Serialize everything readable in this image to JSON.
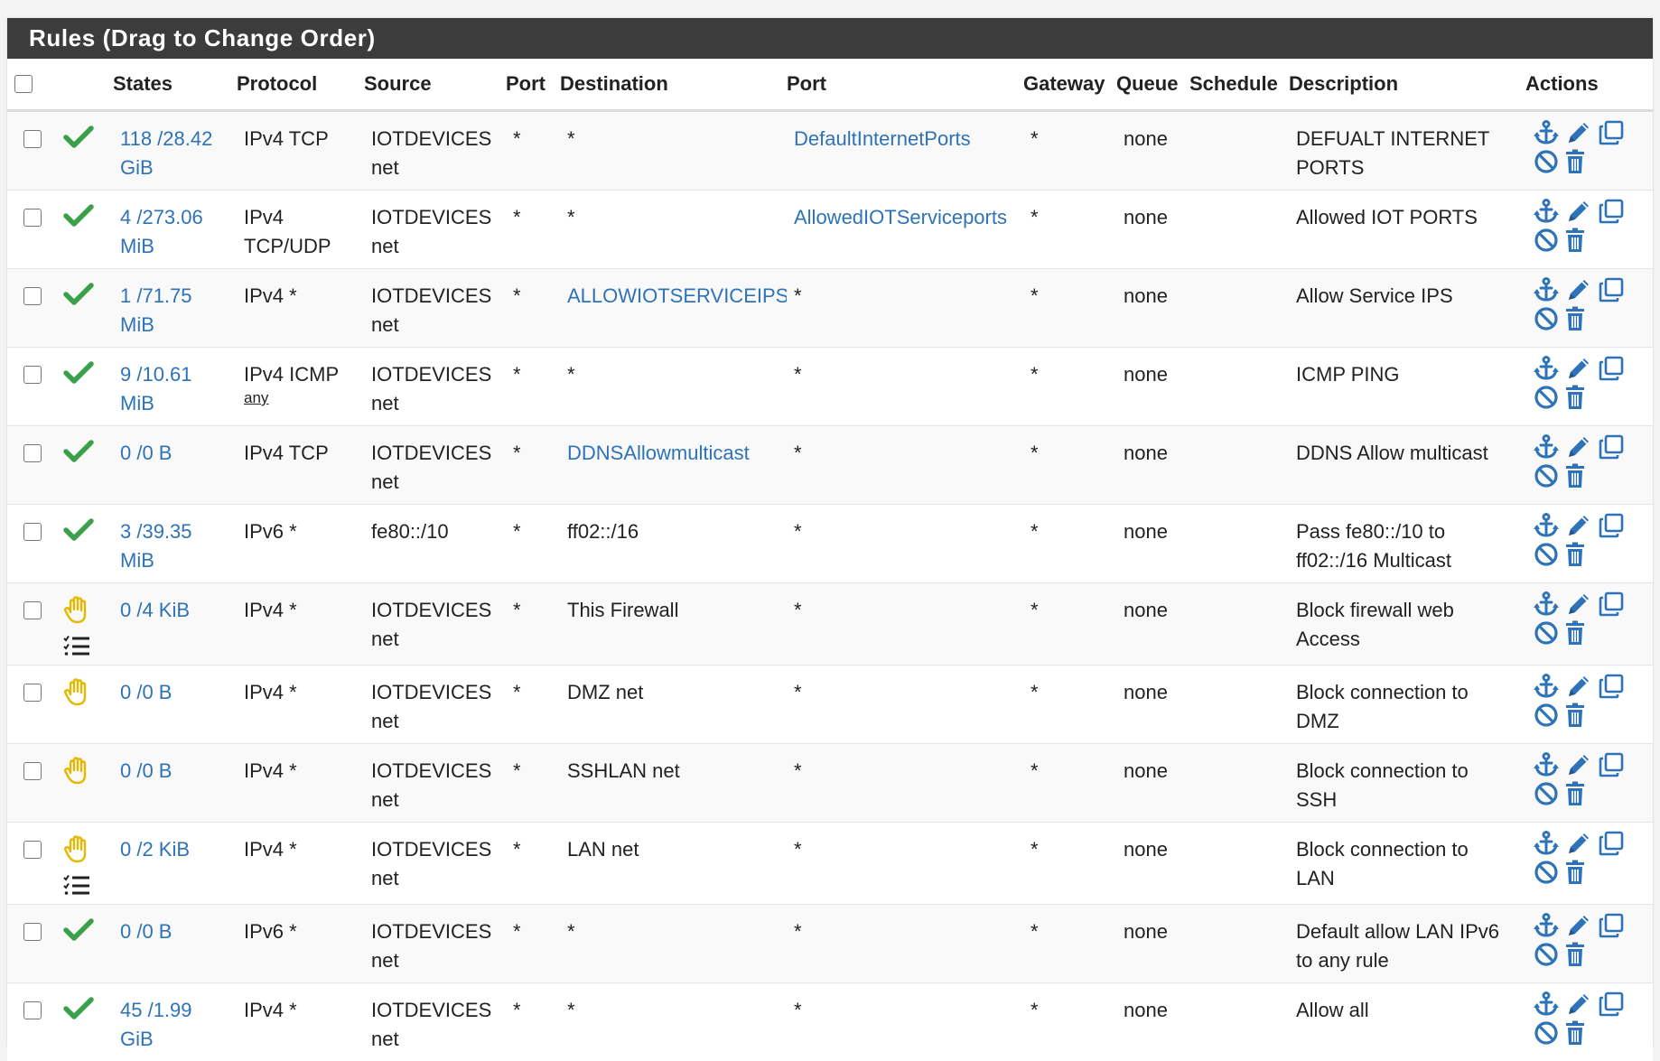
{
  "panel": {
    "title": "Rules (Drag to Change Order)"
  },
  "headers": {
    "states": "States",
    "protocol": "Protocol",
    "source": "Source",
    "source_port": "Port",
    "destination": "Destination",
    "dest_port": "Port",
    "gateway": "Gateway",
    "queue": "Queue",
    "schedule": "Schedule",
    "description": "Description",
    "actions": "Actions"
  },
  "colors": {
    "pass": "#3aa14a",
    "block": "#e6b800",
    "accent": "#2e73b8",
    "header": "#3c3c3c"
  },
  "rows": [
    {
      "status": "pass-check-icon",
      "log": false,
      "states1": "118 /28.42",
      "states2": "GiB",
      "protocol1": "IPv4 TCP",
      "protocol2": "",
      "proto_sub": "",
      "source1": "IOTDEVICES",
      "source2": "net",
      "sport": "*",
      "dest": "*",
      "dest_link": false,
      "dport": "DefaultInternetPorts",
      "dport_link": true,
      "gateway": "*",
      "queue": "none",
      "schedule": "",
      "desc1": "DEFUALT INTERNET",
      "desc2": "PORTS"
    },
    {
      "status": "pass-check-icon",
      "log": false,
      "states1": "4 /273.06",
      "states2": "MiB",
      "protocol1": "IPv4",
      "protocol2": "TCP/UDP",
      "proto_sub": "",
      "source1": "IOTDEVICES",
      "source2": "net",
      "sport": "*",
      "dest": "*",
      "dest_link": false,
      "dport": "AllowedIOTServiceports",
      "dport_link": true,
      "gateway": "*",
      "queue": "none",
      "schedule": "",
      "desc1": "Allowed IOT PORTS",
      "desc2": ""
    },
    {
      "status": "pass-check-icon",
      "log": false,
      "states1": "1 /71.75",
      "states2": "MiB",
      "protocol1": "IPv4 *",
      "protocol2": "",
      "proto_sub": "",
      "source1": "IOTDEVICES",
      "source2": "net",
      "sport": "*",
      "dest": "ALLOWIOTSERVICEIPS",
      "dest_link": true,
      "dport": "*",
      "dport_link": false,
      "gateway": "*",
      "queue": "none",
      "schedule": "",
      "desc1": "Allow Service IPS",
      "desc2": ""
    },
    {
      "status": "pass-check-icon",
      "log": false,
      "states1": "9 /10.61",
      "states2": "MiB",
      "protocol1": "IPv4 ICMP",
      "protocol2": "",
      "proto_sub": "any",
      "source1": "IOTDEVICES",
      "source2": "net",
      "sport": "*",
      "dest": "*",
      "dest_link": false,
      "dport": "*",
      "dport_link": false,
      "gateway": "*",
      "queue": "none",
      "schedule": "",
      "desc1": "ICMP PING",
      "desc2": ""
    },
    {
      "status": "pass-check-icon",
      "log": false,
      "states1": "0 /0 B",
      "states2": "",
      "protocol1": "IPv4 TCP",
      "protocol2": "",
      "proto_sub": "",
      "source1": "IOTDEVICES",
      "source2": "net",
      "sport": "*",
      "dest": "DDNSAllowmulticast",
      "dest_link": true,
      "dport": "*",
      "dport_link": false,
      "gateway": "*",
      "queue": "none",
      "schedule": "",
      "desc1": "DDNS Allow multicast",
      "desc2": ""
    },
    {
      "status": "pass-check-icon",
      "log": false,
      "states1": "3 /39.35",
      "states2": "MiB",
      "protocol1": "IPv6 *",
      "protocol2": "",
      "proto_sub": "",
      "source1": "fe80::/10",
      "source2": "",
      "sport": "*",
      "dest": "ff02::/16",
      "dest_link": false,
      "dport": "*",
      "dport_link": false,
      "gateway": "*",
      "queue": "none",
      "schedule": "",
      "desc1": "Pass fe80::/10 to",
      "desc2": "ff02::/16 Multicast"
    },
    {
      "status": "block-hand-icon",
      "log": true,
      "states1": "0 /4 KiB",
      "states2": "",
      "protocol1": "IPv4 *",
      "protocol2": "",
      "proto_sub": "",
      "source1": "IOTDEVICES",
      "source2": "net",
      "sport": "*",
      "dest": "This Firewall",
      "dest_link": false,
      "dport": "*",
      "dport_link": false,
      "gateway": "*",
      "queue": "none",
      "schedule": "",
      "desc1": "Block firewall web",
      "desc2": "Access"
    },
    {
      "status": "block-hand-icon",
      "log": false,
      "states1": "0 /0 B",
      "states2": "",
      "protocol1": "IPv4 *",
      "protocol2": "",
      "proto_sub": "",
      "source1": "IOTDEVICES",
      "source2": "net",
      "sport": "*",
      "dest": "DMZ net",
      "dest_link": false,
      "dport": "*",
      "dport_link": false,
      "gateway": "*",
      "queue": "none",
      "schedule": "",
      "desc1": "Block connection to",
      "desc2": "DMZ"
    },
    {
      "status": "block-hand-icon",
      "log": false,
      "states1": "0 /0 B",
      "states2": "",
      "protocol1": "IPv4 *",
      "protocol2": "",
      "proto_sub": "",
      "source1": "IOTDEVICES",
      "source2": "net",
      "sport": "*",
      "dest": "SSHLAN net",
      "dest_link": false,
      "dport": "*",
      "dport_link": false,
      "gateway": "*",
      "queue": "none",
      "schedule": "",
      "desc1": "Block connection to",
      "desc2": "SSH"
    },
    {
      "status": "block-hand-icon",
      "log": true,
      "states1": "0 /2 KiB",
      "states2": "",
      "protocol1": "IPv4 *",
      "protocol2": "",
      "proto_sub": "",
      "source1": "IOTDEVICES",
      "source2": "net",
      "sport": "*",
      "dest": "LAN net",
      "dest_link": false,
      "dport": "*",
      "dport_link": false,
      "gateway": "*",
      "queue": "none",
      "schedule": "",
      "desc1": "Block connection to",
      "desc2": "LAN"
    },
    {
      "status": "pass-check-icon",
      "log": false,
      "states1": "0 /0 B",
      "states2": "",
      "protocol1": "IPv6 *",
      "protocol2": "",
      "proto_sub": "",
      "source1": "IOTDEVICES",
      "source2": "net",
      "sport": "*",
      "dest": "*",
      "dest_link": false,
      "dport": "*",
      "dport_link": false,
      "gateway": "*",
      "queue": "none",
      "schedule": "",
      "desc1": "Default allow LAN IPv6",
      "desc2": "to any rule"
    },
    {
      "status": "pass-check-icon",
      "log": false,
      "states1": "45 /1.99",
      "states2": "GiB",
      "protocol1": "IPv4 *",
      "protocol2": "",
      "proto_sub": "",
      "source1": "IOTDEVICES",
      "source2": "net",
      "sport": "*",
      "dest": "*",
      "dest_link": false,
      "dport": "*",
      "dport_link": false,
      "gateway": "*",
      "queue": "none",
      "schedule": "",
      "desc1": "Allow all",
      "desc2": ""
    }
  ]
}
